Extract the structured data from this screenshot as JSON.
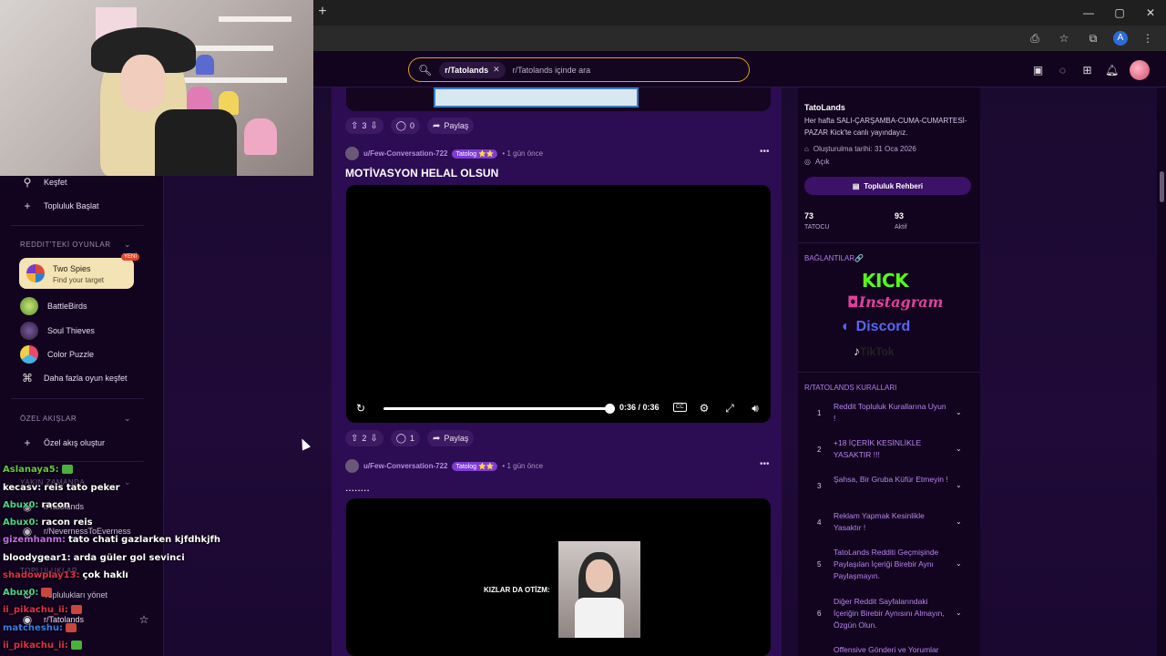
{
  "browser": {
    "new_tab": "+",
    "window_controls": [
      "—",
      "▢",
      "✕"
    ],
    "profile_letter": "A"
  },
  "search": {
    "chip_label": "r/Tatolands",
    "placeholder": "r/Tatolands içinde ara"
  },
  "sidebar": {
    "explore": "Keşfet",
    "start_community": "Topluluk Başlat",
    "games_header": "REDDIT'TEKİ OYUNLAR",
    "featured_game": {
      "title": "Two Spies",
      "subtitle": "Find your target",
      "badge": "YENİ"
    },
    "games": [
      "BattleBirds",
      "Soul Thieves",
      "Color Puzzle"
    ],
    "more_games": "Daha fazla oyun keşfet",
    "custom_header": "ÖZEL AKIŞLAR",
    "create_custom": "Özel akış oluştur",
    "recent_header": "YAKIN ZAMANDA",
    "recent_items": [
      "r/Tatolands",
      "r/NevernessToEverness"
    ],
    "communities_header": "TOPLULUKLAR",
    "manage_communities": "Toplulukları yönet",
    "community_item": "r/Tatolands"
  },
  "chat": [
    {
      "user": "Aslanaya5:",
      "msg": "",
      "color": "#67c63b"
    },
    {
      "user": "kecasv:",
      "msg": "reis tato peker",
      "color": "#ffffff"
    },
    {
      "user": "Abux0:",
      "msg": "racon",
      "color": "#4fd38a"
    },
    {
      "user": "Abux0:",
      "msg": "racon reis",
      "color": "#4fd38a"
    },
    {
      "user": "gizemhanm:",
      "msg": "tato chati gazlarken kjfdhkjfh",
      "color": "#c06be0"
    },
    {
      "user": "bloodygear1:",
      "msg": "arda güler gol sevinci",
      "color": "#ffffff"
    },
    {
      "user": "shadowplay13:",
      "msg": "çok haklı",
      "color": "#e0304a"
    },
    {
      "user": "Abux0:",
      "msg": "",
      "color": "#4fd38a"
    },
    {
      "user": "ii_pikachu_ii:",
      "msg": "",
      "color": "#e0304a"
    },
    {
      "user": "matcheshu:",
      "msg": "",
      "color": "#3d7be0"
    },
    {
      "user": "ii_pikachu_ii:",
      "msg": "",
      "color": "#e0304a"
    }
  ],
  "posts": [
    {
      "upvotes": "3",
      "comments": "0",
      "share": "Paylaş"
    },
    {
      "author": "u/Few-Conversation-722",
      "flair": "Tatolog ⭐⭐",
      "time": "• 1 gün önce",
      "title": "MOTİVASYON HELAL OLSUN",
      "video_time": "0:36 / 0:36",
      "cc": "CC",
      "upvotes": "2",
      "comments": "1",
      "share": "Paylaş"
    },
    {
      "author": "u/Few-Conversation-722",
      "flair": "Tatolog ⭐⭐",
      "time": "• 1 gün önce",
      "title": "........",
      "overlay_text": "KIZLAR DA OTİZM:"
    }
  ],
  "community": {
    "name": "TatoLands",
    "description": "Her hafta SALI-ÇARŞAMBA-CUMA-CUMARTESİ-PAZAR Kick'te canlı yayındayız.",
    "created": "Oluşturulma tarihi: 31 Oca 2026",
    "visibility": "Açık",
    "guide_button": "Topluluk Rehberi",
    "members_count": "73",
    "members_label": "TATOCU",
    "active_count": "93",
    "active_label": "Aktif",
    "links_header": "BAĞLANTILAR🔗",
    "links": [
      "KICK",
      "Instagram",
      "Discord",
      "TikTok"
    ],
    "rules_header": "R/TATOLANDS KURALLARI",
    "rules": [
      "Reddit Topluluk Kurallarına Uyun !",
      "+18 İÇERİK KESİNLİKLE YASAKTIR !!!",
      "Şahsa, Bir Gruba Küfür Etmeyin !",
      "Reklam Yapmak Kesinlikle Yasaktır !",
      "TatoLands Redditi Geçmişinde Paylaşılan İçeriği Birebir Aynı Paylaşmayın.",
      "Diğer Reddit Sayfalarındaki İçeriğin Birebir Aynısını Almayın, Özgün Olun.",
      "Offensive Gönderi ve Yorumlar"
    ],
    "rule_numbers": [
      "1",
      "2",
      "3",
      "4",
      "5",
      "6"
    ]
  },
  "colors": {
    "accent": "#e49b28",
    "purple": "#7e3bd6",
    "kick": "#53fc18"
  }
}
